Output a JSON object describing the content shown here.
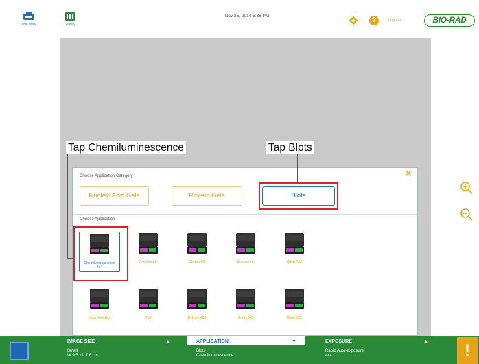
{
  "header": {
    "live_view_label": "Live View",
    "gallery_label": "Gallery",
    "datetime": "Nov 25, 2014  5:38 PM",
    "logout_label": "Log Out",
    "logo_text": "BIO-RAD",
    "accent_color": "#e8a21a",
    "brand_color": "#2a8a3a"
  },
  "callouts": {
    "left": "Tap Chemiluminescence",
    "right": "Tap Blots"
  },
  "dialog": {
    "category_heading": "Choose Application Category",
    "categories": [
      {
        "label": "Nucleic Acid Gels",
        "selected": false
      },
      {
        "label": "Protein Gels",
        "selected": false
      },
      {
        "label": "Blots",
        "selected": true
      }
    ],
    "application_heading": "Choose Application",
    "applications": [
      {
        "label": "Chemiluminescence\n4x4",
        "selected": true
      },
      {
        "label": "Colorimetric",
        "selected": false
      },
      {
        "label": "Alexa 488",
        "selected": false
      },
      {
        "label": "Fluorescein",
        "selected": false
      },
      {
        "label": "Qdots 565",
        "selected": false
      },
      {
        "label": "Stain Free Blot",
        "selected": false
      },
      {
        "label": "Cy3",
        "selected": false
      },
      {
        "label": "DyLight 488",
        "selected": false
      },
      {
        "label": "Qdots 525",
        "selected": false
      },
      {
        "label": "Qdots 625",
        "selected": false
      }
    ]
  },
  "bottom_bar": {
    "image_size": {
      "title": "IMAGE SIZE",
      "line1": "Small",
      "line2": "W 9.5 x L 7.6 cm"
    },
    "application": {
      "title": "APPLICATION",
      "line1": "Blots",
      "line2": "Chemiluminescence"
    },
    "exposure": {
      "title": "EXPOSURE",
      "line1": "Rapid Auto-exposure",
      "line2": "4x4"
    },
    "alert_symbol": "!"
  }
}
